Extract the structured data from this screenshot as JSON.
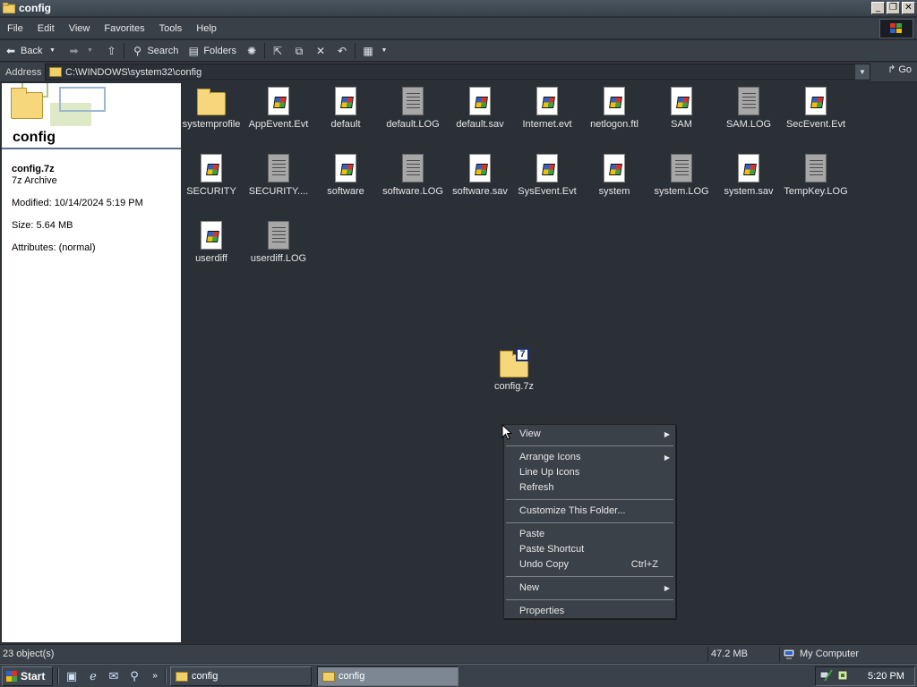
{
  "window": {
    "title": "config"
  },
  "menu": [
    "File",
    "Edit",
    "View",
    "Favorites",
    "Tools",
    "Help"
  ],
  "toolbar": {
    "back": "Back",
    "search": "Search",
    "folders": "Folders",
    "icons": [
      "back-arrow-icon",
      "forward-arrow-icon",
      "up-folder-icon",
      "search-icon",
      "folders-icon",
      "history-icon",
      "move-to-icon",
      "copy-to-icon",
      "delete-icon",
      "undo-icon",
      "views-icon"
    ]
  },
  "address": {
    "label": "Address",
    "path": "C:\\WINDOWS\\system32\\config",
    "go": "Go"
  },
  "leftpane": {
    "title": "config",
    "filename": "config.7z",
    "filetype": "7z Archive",
    "modified": "Modified: 10/14/2024 5:19 PM",
    "size": "Size: 5.64 MB",
    "attributes": "Attributes: (normal)"
  },
  "files": [
    {
      "name": "systemprofile",
      "kind": "folder"
    },
    {
      "name": "AppEvent.Evt",
      "kind": "winfile"
    },
    {
      "name": "default",
      "kind": "winfile"
    },
    {
      "name": "default.LOG",
      "kind": "textfile"
    },
    {
      "name": "default.sav",
      "kind": "winfile"
    },
    {
      "name": "Internet.evt",
      "kind": "winfile"
    },
    {
      "name": "netlogon.ftl",
      "kind": "winfile"
    },
    {
      "name": "SAM",
      "kind": "winfile"
    },
    {
      "name": "SAM.LOG",
      "kind": "textfile"
    },
    {
      "name": "SecEvent.Evt",
      "kind": "winfile"
    },
    {
      "name": "SECURITY",
      "kind": "winfile"
    },
    {
      "name": "SECURITY....",
      "kind": "textfile"
    },
    {
      "name": "software",
      "kind": "winfile"
    },
    {
      "name": "software.LOG",
      "kind": "textfile"
    },
    {
      "name": "software.sav",
      "kind": "winfile"
    },
    {
      "name": "SysEvent.Evt",
      "kind": "winfile"
    },
    {
      "name": "system",
      "kind": "winfile"
    },
    {
      "name": "system.LOG",
      "kind": "textfile"
    },
    {
      "name": "system.sav",
      "kind": "winfile"
    },
    {
      "name": "TempKey.LOG",
      "kind": "textfile"
    },
    {
      "name": "userdiff",
      "kind": "winfile"
    },
    {
      "name": "userdiff.LOG",
      "kind": "textfile"
    }
  ],
  "archive": {
    "name": "config.7z",
    "badge": "7"
  },
  "context_menu": {
    "view": "View",
    "arrange_icons": "Arrange Icons",
    "line_up_icons": "Line Up Icons",
    "refresh": "Refresh",
    "customize": "Customize This Folder...",
    "paste": "Paste",
    "paste_shortcut": "Paste Shortcut",
    "undo_copy": "Undo Copy",
    "undo_copy_shortcut": "Ctrl+Z",
    "new": "New",
    "properties": "Properties"
  },
  "status": {
    "objects": "23 object(s)",
    "size": "47.2 MB",
    "location": "My Computer"
  },
  "taskbar": {
    "start": "Start",
    "tasks": [
      "config",
      "config"
    ],
    "clock": "5:20 PM",
    "quicklaunch": [
      "show-desktop-icon",
      "internet-explorer-icon",
      "outlook-express-icon",
      "search-icon"
    ]
  },
  "colors": {
    "background": "#2b3037",
    "pane": "#ffffff",
    "bars": "#3a4048",
    "accent": "#1d2f6b"
  }
}
